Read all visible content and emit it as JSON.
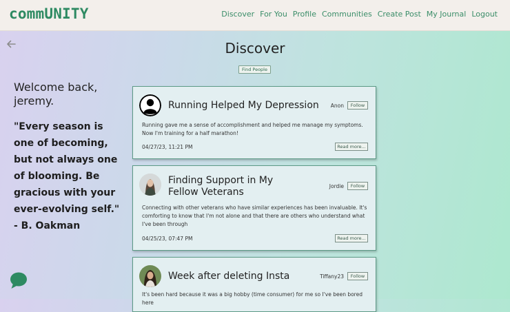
{
  "brand": "commUNITY",
  "nav": [
    "Discover",
    "For You",
    "Profile",
    "Communities",
    "Create Post",
    "My Journal",
    "Logout"
  ],
  "page": {
    "title": "Discover",
    "find_people": "Find People"
  },
  "sidebar": {
    "welcome": "Welcome back, jeremy.",
    "quote": "\"Every season is one of becoming, but not always one of blooming. Be gracious with your ever-evolving self.\" - B. Oakman"
  },
  "posts": [
    {
      "title": "Running Helped My Depression",
      "author": "Anon",
      "follow": "Follow",
      "body": "Running gave me a sense of accomplishment and helped me manage my symptoms. Now I'm training for a half marathon!",
      "date": "04/27/23, 11:21 PM",
      "read_more": "Read more..."
    },
    {
      "title": "Finding Support in My Fellow Veterans",
      "author": "Jordie",
      "follow": "Follow",
      "body": "Connecting with other veterans who have similar experiences has been invaluable. It's comforting to know that I'm not alone and that there are others who understand what I've been through",
      "date": "04/25/23, 07:47 PM",
      "read_more": "Read more..."
    },
    {
      "title": "Week after deleting Insta",
      "author": "Tiffany23",
      "follow": "Follow",
      "body": "It's been hard because it was a big hobby (time consumer) for me so I've been bored here"
    }
  ],
  "colors": {
    "brand": "#2e8a62",
    "nav_link": "#3a8d68",
    "card_border": "#5c9a86",
    "card_bg": "#e3eff1"
  },
  "icons": {
    "back": "arrow-left-icon",
    "chat": "chat-bubble-icon",
    "avatar_default": "user-silhouette-icon"
  }
}
